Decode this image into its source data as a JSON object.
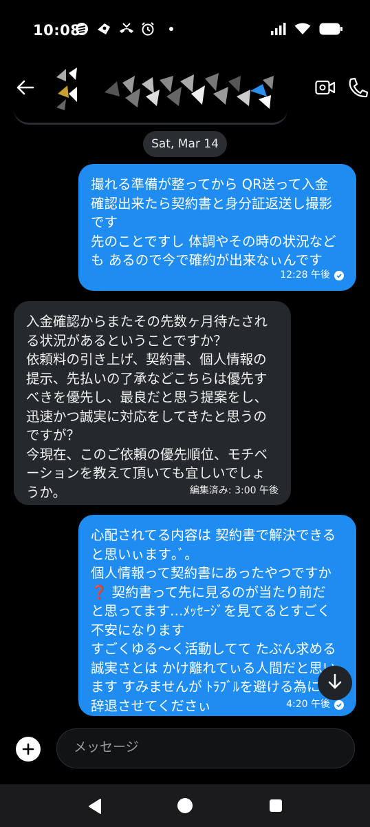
{
  "status_bar": {
    "time": "10:08",
    "icons": [
      "notification-icon",
      "game-icon",
      "missed-call-icon",
      "alarm-icon",
      "dot-icon"
    ],
    "right_icons": [
      "signal-icon",
      "wifi-icon",
      "battery-icon"
    ]
  },
  "header": {
    "back_icon": "arrow-left-icon",
    "video_icon": "video-camera-icon",
    "call_icon": "phone-icon"
  },
  "date_separator": "Sat, Mar 14",
  "messages": [
    {
      "direction": "outgoing",
      "text": "撮れる準備が整ってから QR送って入金\n確認出来たら契約書と身分証返送し撮影\nです\n先のことですし 体調やその時の状況など\nも あるので今で確約が出来なぃんです",
      "time": "12:28 午後",
      "status_icon": "read-check-icon"
    },
    {
      "direction": "incoming",
      "text": "入金確認からまたその先数ヶ月待たされ\nる状況があるということですか？\n依頼料の引き上げ、契約書、個人情報の\n提示、先払いの了承などこちらは優先す\nべきを優先し、最良だと思う提案をし、\n迅速かつ誠実に対応をしてきたと思うの\nですが？\n今現在、このご依頼の優先順位、モチベ\nーションを教えて頂いても宜しいでしょ\nうか。",
      "time": "編集済み: 3:00 午後"
    },
    {
      "direction": "outgoing",
      "text": "心配されてる内容は 契約書で解決できる\nと思いぃます｡ﾞ｡\n個人情報って契約書にあったやつですか\n❓ 契約書って先に見るのが当たり前だ\nと思ってます…ﾒｯｾｰｼﾞを見てるとすごく\n不安になります\nすごくゆる〜く活動してて たぶん求める\n誠実さとは かけ離れてぃる人間だと思い\nます すみませんが ﾄﾗﾌﾞﾙを避ける為に\n辞退させてくださぃ",
      "time": "4:20 午後",
      "status_icon": "read-check-icon"
    }
  ],
  "composer": {
    "placeholder": "メッセージ",
    "add_icon": "plus-circle-icon"
  },
  "scroll_down_icon": "arrow-down-icon",
  "nav_bar": [
    "back-triangle-icon",
    "home-circle-icon",
    "recents-square-icon"
  ]
}
